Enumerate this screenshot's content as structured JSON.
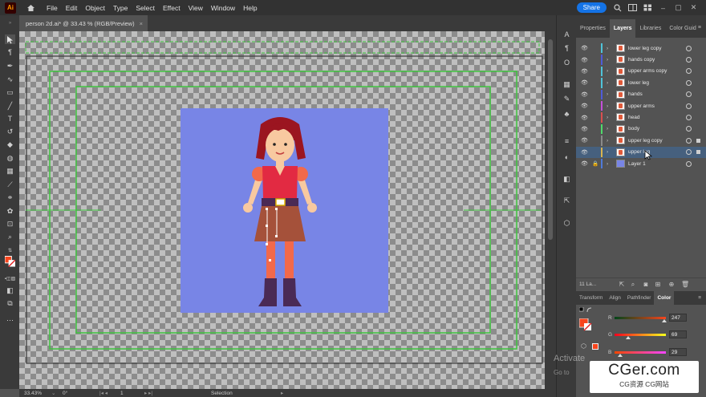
{
  "menubar": {
    "logo": "Ai",
    "items": [
      "File",
      "Edit",
      "Object",
      "Type",
      "Select",
      "Effect",
      "View",
      "Window",
      "Help"
    ],
    "share_label": "Share"
  },
  "document_tab": {
    "title": "person 2d.ai* @ 33.43 % (RGB/Preview)",
    "close": "×"
  },
  "statusbar": {
    "zoom": "33.43%",
    "rotation": "0°",
    "artboard": "1",
    "tool": "Selection"
  },
  "layers_panel": {
    "tabs": [
      "Properties",
      "Layers",
      "Libraries",
      "Color Guid"
    ],
    "active_tab": "Layers",
    "layers": [
      {
        "name": "lower leg copy",
        "color": "#4fc3d9"
      },
      {
        "name": "hands copy",
        "color": "#4f5bd9"
      },
      {
        "name": "upper arms copy",
        "color": "#4fc3d9"
      },
      {
        "name": "lower leg",
        "color": "#4fc3d9"
      },
      {
        "name": "hands",
        "color": "#4f5bd9"
      },
      {
        "name": "upper arms",
        "color": "#c44fd9"
      },
      {
        "name": "head",
        "color": "#d94f4f"
      },
      {
        "name": "body",
        "color": "#4fd96a"
      },
      {
        "name": "upper leg copy",
        "color": "#8a8a8a"
      },
      {
        "name": "upper leg",
        "color": "#d9b44f"
      },
      {
        "name": "Layer 1",
        "color": "#4f7ad9"
      }
    ],
    "layer_count": "11 La..."
  },
  "color_panel": {
    "tabs": [
      "Transform",
      "Align",
      "Pathfinder",
      "Color"
    ],
    "active_tab": "Color",
    "channels": [
      {
        "label": "R",
        "value": "247",
        "fraction": 0.97
      },
      {
        "label": "G",
        "value": "69",
        "fraction": 0.27
      },
      {
        "label": "B",
        "value": "29",
        "fraction": 0.11
      }
    ],
    "fill_color": "#f7451d"
  },
  "overlay": {
    "activate_title": "Activate",
    "activate_sub": "Go to",
    "watermark_main": "CGer.com",
    "watermark_sub": "CG资源 CG网站"
  },
  "colors": {
    "artboard_bg": "#7885e6",
    "guides": "#3ec43e",
    "accent": "#1473e6"
  }
}
